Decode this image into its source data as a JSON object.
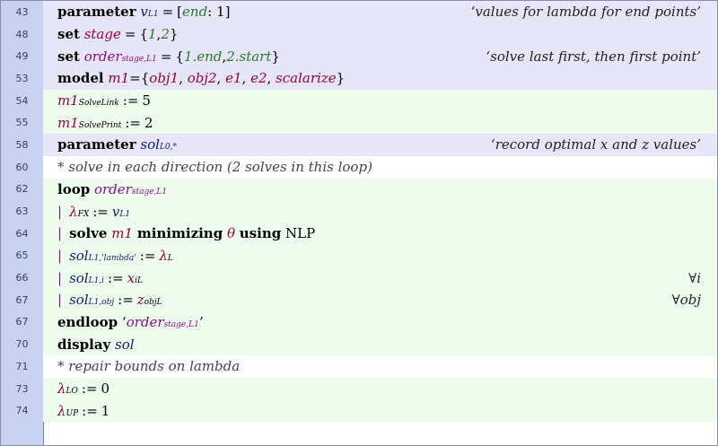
{
  "lines": [
    {
      "n": "43",
      "kind": "hdr"
    },
    {
      "n": "48",
      "kind": "hdr"
    },
    {
      "n": "49",
      "kind": "hdr"
    },
    {
      "n": "53",
      "kind": "hdr"
    },
    {
      "n": "54",
      "kind": "asg"
    },
    {
      "n": "55",
      "kind": "asg"
    },
    {
      "n": "58",
      "kind": "hdr"
    },
    {
      "n": "60",
      "kind": "cmt"
    },
    {
      "n": "62",
      "kind": "asg"
    },
    {
      "n": "63",
      "kind": "asg"
    },
    {
      "n": "64",
      "kind": "asg"
    },
    {
      "n": "65",
      "kind": "asg"
    },
    {
      "n": "66",
      "kind": "asg"
    },
    {
      "n": "67",
      "kind": "asg"
    },
    {
      "n": "67",
      "kind": "asg"
    },
    {
      "n": "70",
      "kind": "asg"
    },
    {
      "n": "71",
      "kind": "cmt"
    },
    {
      "n": "73",
      "kind": "asg"
    },
    {
      "n": "74",
      "kind": "asg"
    }
  ],
  "t": {
    "parameter": "parameter",
    "set": "set",
    "model": "model",
    "loop": "loop",
    "solve": "solve",
    "minimizing": "minimizing",
    "using": "using",
    "endloop": "endloop",
    "display": "display",
    "assign": ":=",
    "eq": "=",
    "v": "v",
    "L1": "L1",
    "end_val": "end",
    "one": "1",
    "stage": "stage",
    "order": "order",
    "stage_L1": "stage,L1",
    "m1": "m1",
    "obj1": "obj1",
    "obj2": "obj2",
    "e1": "e1",
    "e2": "e2",
    "scalarize": "scalarize",
    "SolveLink": "SolveLink",
    "SolvePrint": "SolvePrint",
    "five": "5",
    "two": "2",
    "zero": "0",
    "sol": "sol",
    "L0star": "L0,*",
    "lambda": "λ",
    "FX": "FX",
    "L": "L",
    "LO": "LO",
    "UP": "UP",
    "theta": "θ",
    "NLP": "NLP",
    "L1_lambda": "L1,'lambda'",
    "L1_i": "L1,i",
    "L1_obj": "L1,obj",
    "x": "x",
    "z": "z",
    "i": "i",
    "obj": "obj",
    "bar": "|",
    "one_end": "1.end",
    "two_start": "2.start",
    "set_open": "{",
    "set_close": "}",
    "br_open": "[",
    "br_close": "]",
    "colon_sp": ": ",
    "comma": ",",
    "c_sep": ", ",
    "q_open": "‘",
    "q_close": "’",
    "forall_i": "∀i",
    "forall_obj": "∀obj",
    "c43": "‘values for lambda for end points’",
    "c49": "‘solve last first, then first point’",
    "c58": "‘record optimal x and z values’",
    "c60": "* solve in each direction (2 solves in this loop)",
    "c71": "* repair bounds on lambda"
  }
}
